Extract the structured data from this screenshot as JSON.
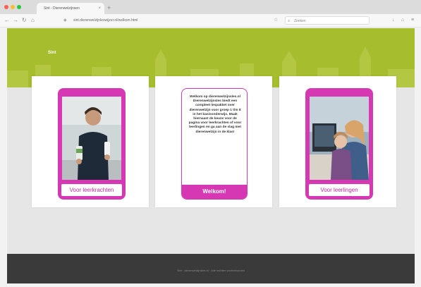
{
  "browser": {
    "tab_title": "Sint - Dierenwelzijnsen",
    "tab_close": "×",
    "new_tab": "+",
    "url": "sint.dierenwelzijnleswijzer.nl/welkom.html",
    "search_placeholder": "Zoeken"
  },
  "hero": {
    "title": "Sint",
    "color": "#a6bd2e"
  },
  "cards": [
    {
      "button_label": "Voor leerkrachten",
      "photo": "teacher-photo"
    },
    {
      "text": "Welkom op dierenwelzijnsles.nl Dierenwelzijnsles biedt een compleet lespakket over dierenwelzijn voor groep 1 t/m 8 in het basisonderwijs. Maak hiernaast de keuze voor de pagina voor leerkrachten of voor leerlingen en ga aan de slag met dierenwelzijn in de klas!",
      "button_label": "Welkom!"
    },
    {
      "button_label": "Voor leerlingen",
      "photo": "students-photo"
    }
  ],
  "footer": {
    "text": "Sint · dierenwelzijnsles.nl · Alle rechten voorbehouden"
  },
  "colors": {
    "accent": "#d638b4",
    "footer_bg": "#3a3a3a"
  }
}
